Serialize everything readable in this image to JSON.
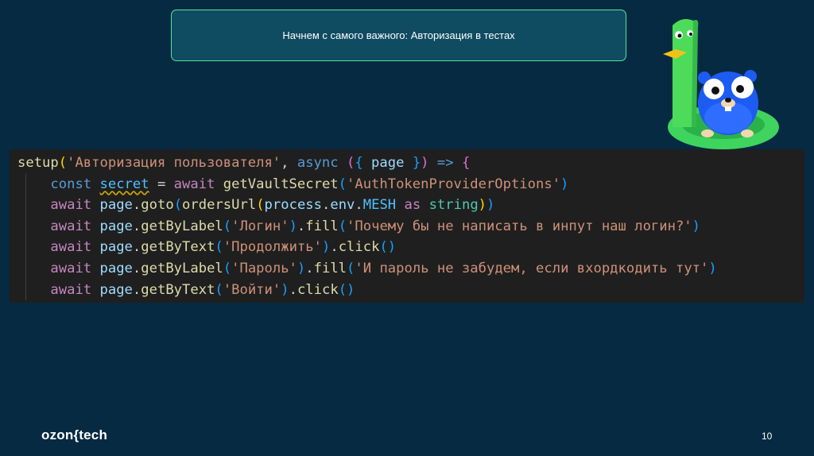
{
  "slide": {
    "title": "Начнем с самого важного: Авторизация в тестах",
    "page_number": "10",
    "logo_text": "ozon",
    "logo_suffix": "tech"
  },
  "code": {
    "language": "typescript",
    "lines": [
      [
        {
          "t": "setup",
          "c": "fn"
        },
        {
          "t": "(",
          "c": "brk1"
        },
        {
          "t": "'Авторизация пользователя'",
          "c": "str"
        },
        {
          "t": ", ",
          "c": "op"
        },
        {
          "t": "async",
          "c": "kw"
        },
        {
          "t": " ",
          "c": "op"
        },
        {
          "t": "(",
          "c": "brk2"
        },
        {
          "t": "{",
          "c": "brk3"
        },
        {
          "t": " ",
          "c": "op"
        },
        {
          "t": "page",
          "c": "var"
        },
        {
          "t": " ",
          "c": "op"
        },
        {
          "t": "}",
          "c": "brk3"
        },
        {
          "t": ")",
          "c": "brk2"
        },
        {
          "t": " ",
          "c": "op"
        },
        {
          "t": "=>",
          "c": "kw"
        },
        {
          "t": " ",
          "c": "op"
        },
        {
          "t": "{",
          "c": "brk2"
        }
      ],
      [
        {
          "t": "    ",
          "c": "op"
        },
        {
          "t": "const",
          "c": "kw"
        },
        {
          "t": " ",
          "c": "op"
        },
        {
          "t": "secret",
          "c": "const-var squiggle"
        },
        {
          "t": " = ",
          "c": "op"
        },
        {
          "t": "await",
          "c": "kw2"
        },
        {
          "t": " ",
          "c": "op"
        },
        {
          "t": "getVaultSecret",
          "c": "fn"
        },
        {
          "t": "(",
          "c": "brk3"
        },
        {
          "t": "'AuthTokenProviderOptions'",
          "c": "str"
        },
        {
          "t": ")",
          "c": "brk3"
        }
      ],
      [
        {
          "t": "    ",
          "c": "op"
        },
        {
          "t": "await",
          "c": "kw2"
        },
        {
          "t": " ",
          "c": "op"
        },
        {
          "t": "page",
          "c": "var"
        },
        {
          "t": ".",
          "c": "op"
        },
        {
          "t": "goto",
          "c": "fn"
        },
        {
          "t": "(",
          "c": "brk3"
        },
        {
          "t": "ordersUrl",
          "c": "fn"
        },
        {
          "t": "(",
          "c": "brk1"
        },
        {
          "t": "process",
          "c": "var"
        },
        {
          "t": ".",
          "c": "op"
        },
        {
          "t": "env",
          "c": "var"
        },
        {
          "t": ".",
          "c": "op"
        },
        {
          "t": "MESH",
          "c": "const-var"
        },
        {
          "t": " ",
          "c": "op"
        },
        {
          "t": "as",
          "c": "kw2"
        },
        {
          "t": " ",
          "c": "op"
        },
        {
          "t": "string",
          "c": "type"
        },
        {
          "t": ")",
          "c": "brk1"
        },
        {
          "t": ")",
          "c": "brk3"
        }
      ],
      [
        {
          "t": "    ",
          "c": "op"
        },
        {
          "t": "await",
          "c": "kw2"
        },
        {
          "t": " ",
          "c": "op"
        },
        {
          "t": "page",
          "c": "var"
        },
        {
          "t": ".",
          "c": "op"
        },
        {
          "t": "getByLabel",
          "c": "fn"
        },
        {
          "t": "(",
          "c": "brk3"
        },
        {
          "t": "'Логин'",
          "c": "str"
        },
        {
          "t": ")",
          "c": "brk3"
        },
        {
          "t": ".",
          "c": "op"
        },
        {
          "t": "fill",
          "c": "fn"
        },
        {
          "t": "(",
          "c": "brk3"
        },
        {
          "t": "'Почему бы не написать в инпут наш логин?'",
          "c": "str"
        },
        {
          "t": ")",
          "c": "brk3"
        }
      ],
      [
        {
          "t": "    ",
          "c": "op"
        },
        {
          "t": "await",
          "c": "kw2"
        },
        {
          "t": " ",
          "c": "op"
        },
        {
          "t": "page",
          "c": "var"
        },
        {
          "t": ".",
          "c": "op"
        },
        {
          "t": "getByText",
          "c": "fn"
        },
        {
          "t": "(",
          "c": "brk3"
        },
        {
          "t": "'Продолжить'",
          "c": "str"
        },
        {
          "t": ")",
          "c": "brk3"
        },
        {
          "t": ".",
          "c": "op"
        },
        {
          "t": "click",
          "c": "fn"
        },
        {
          "t": "()",
          "c": "brk3"
        }
      ],
      [
        {
          "t": "    ",
          "c": "op"
        },
        {
          "t": "await",
          "c": "kw2"
        },
        {
          "t": " ",
          "c": "op"
        },
        {
          "t": "page",
          "c": "var"
        },
        {
          "t": ".",
          "c": "op"
        },
        {
          "t": "getByLabel",
          "c": "fn"
        },
        {
          "t": "(",
          "c": "brk3"
        },
        {
          "t": "'Пароль'",
          "c": "str"
        },
        {
          "t": ")",
          "c": "brk3"
        },
        {
          "t": ".",
          "c": "op"
        },
        {
          "t": "fill",
          "c": "fn"
        },
        {
          "t": "(",
          "c": "brk3"
        },
        {
          "t": "'И пароль не забудем, если вхордкодить тут'",
          "c": "str"
        },
        {
          "t": ")",
          "c": "brk3"
        }
      ],
      [
        {
          "t": "    ",
          "c": "op"
        },
        {
          "t": "await",
          "c": "kw2"
        },
        {
          "t": " ",
          "c": "op"
        },
        {
          "t": "page",
          "c": "var"
        },
        {
          "t": ".",
          "c": "op"
        },
        {
          "t": "getByText",
          "c": "fn"
        },
        {
          "t": "(",
          "c": "brk3"
        },
        {
          "t": "'Войти'",
          "c": "str"
        },
        {
          "t": ")",
          "c": "brk3"
        },
        {
          "t": ".",
          "c": "op"
        },
        {
          "t": "click",
          "c": "fn"
        },
        {
          "t": "()",
          "c": "brk3"
        }
      ]
    ]
  },
  "colors": {
    "background": "#062a42",
    "title_box_bg": "#0f4b61",
    "title_box_border": "#59e29a",
    "code_bg": "#1f1f1f"
  },
  "mascot": {
    "icon": "gopher-and-green-duck-mascot-icon"
  }
}
